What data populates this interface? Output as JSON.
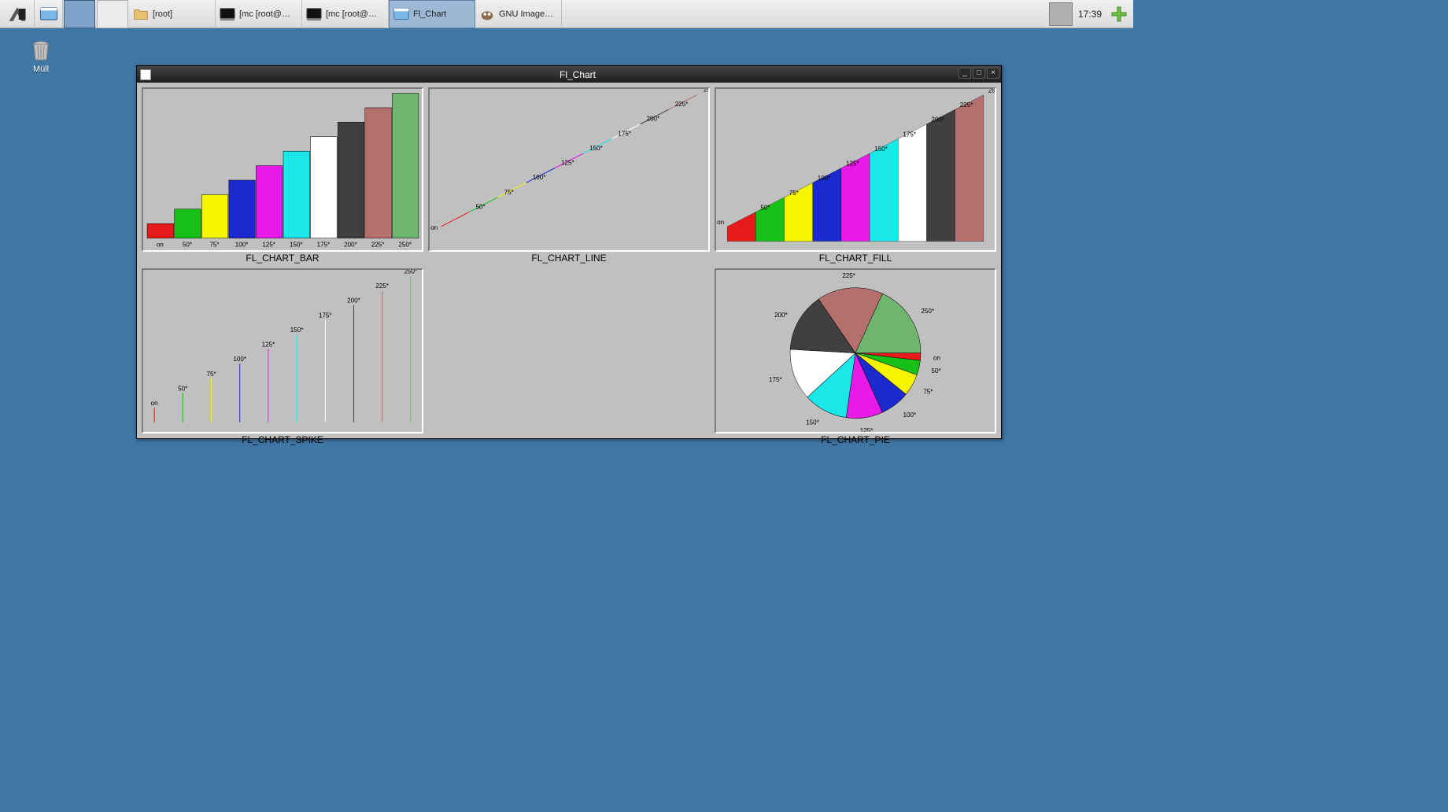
{
  "taskbar": {
    "tasks": [
      {
        "label": "[root]",
        "icon": "folder",
        "active": false
      },
      {
        "label": "[mc [root@…",
        "icon": "terminal",
        "active": false
      },
      {
        "label": "[mc [root@…",
        "icon": "terminal",
        "active": false
      },
      {
        "label": "Fl_Chart",
        "icon": "app-window",
        "active": true
      },
      {
        "label": "GNU Image…",
        "icon": "gimp",
        "active": false
      }
    ],
    "clock": "17:39"
  },
  "desktop": {
    "trash_label": "Müll"
  },
  "window": {
    "title": "Fl_Chart",
    "charts": [
      {
        "label": "FL_CHART_BAR"
      },
      {
        "label": "FL_CHART_LINE"
      },
      {
        "label": "FL_CHART_FILL"
      },
      {
        "label": "FL_CHART_SPIKE"
      },
      {
        "label": ""
      },
      {
        "label": "FL_CHART_PIE"
      }
    ]
  },
  "chart_data": {
    "categories": [
      "on",
      "50*",
      "75*",
      "100*",
      "125*",
      "150*",
      "175*",
      "200*",
      "225*",
      "250*"
    ],
    "values": [
      25,
      50,
      75,
      100,
      125,
      150,
      175,
      200,
      225,
      250
    ],
    "colors": [
      "#e81a1a",
      "#16c016",
      "#f5f500",
      "#1a2acc",
      "#e81ae8",
      "#1ae8e8",
      "#ffffff",
      "#404040",
      "#b56f6f",
      "#6fb56f"
    ],
    "panels": [
      {
        "type": "bar",
        "title": "FL_CHART_BAR"
      },
      {
        "type": "line",
        "title": "FL_CHART_LINE"
      },
      {
        "type": "fill",
        "title": "FL_CHART_FILL"
      },
      {
        "type": "spike",
        "title": "FL_CHART_SPIKE"
      },
      {
        "type": "pie",
        "title": "FL_CHART_PIE"
      }
    ]
  }
}
